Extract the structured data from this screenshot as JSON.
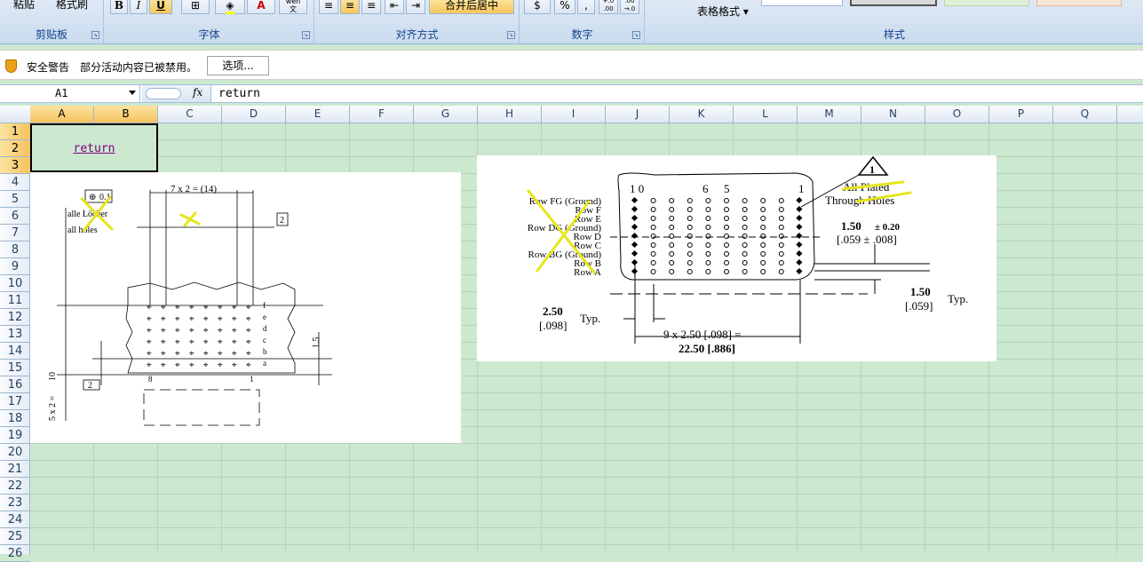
{
  "ribbon": {
    "clipboard": {
      "label": "剪贴板",
      "paste": "粘贴",
      "format_painter": "格式刷"
    },
    "font": {
      "label": "字体",
      "bold": "B",
      "italic": "I",
      "underline": "U",
      "font_color": "A",
      "phonetic": "wén\n文"
    },
    "alignment": {
      "label": "对齐方式",
      "merge_center": "合并后居中"
    },
    "number": {
      "label": "数字",
      "percent": "%",
      "comma": ",",
      "inc_dec": "+.0\n.00",
      "dec_dec": ".00\n→.0"
    },
    "styles": {
      "label": "样式",
      "table_format": "表格格式"
    }
  },
  "security_bar": {
    "title": "安全警告",
    "message": "部分活动内容已被禁用。",
    "options_button": "选项..."
  },
  "formula_bar": {
    "name_box": "A1",
    "fx": "fx",
    "content": "return"
  },
  "columns": [
    "A",
    "B",
    "C",
    "D",
    "E",
    "F",
    "G",
    "H",
    "I",
    "J",
    "K",
    "L",
    "M",
    "N",
    "O",
    "P",
    "Q"
  ],
  "rows": [
    "1",
    "2",
    "3",
    "4",
    "5",
    "6",
    "7",
    "8",
    "9",
    "10",
    "11",
    "12",
    "13",
    "14",
    "15",
    "16",
    "17",
    "18",
    "19",
    "20",
    "21",
    "22",
    "23",
    "24",
    "25",
    "26"
  ],
  "cell_a1": {
    "text": "return"
  },
  "image_left": {
    "dim_top": "7 x  2  =  (14)",
    "tol": "0.1",
    "note1": "alle Löcher",
    "note2": "all holes",
    "box2_a": "2",
    "box2_b": "2",
    "box2_c": "2",
    "rows_labels": [
      "f",
      "e",
      "d",
      "c",
      "b",
      "a"
    ],
    "pin_8": "8",
    "pin_1": "1",
    "dim_right": "1.5",
    "dim_left_a": "10",
    "dim_left_b": "5 x 2 ="
  },
  "image_right": {
    "col_labels": [
      "1 0",
      "6",
      "5",
      "1"
    ],
    "triangle": "1",
    "plated": "All Plated",
    "through": "Through Holes",
    "row_labels": [
      "Row FG (Ground)",
      "Row F",
      "Row E",
      "Row DG (Ground)",
      "Row D",
      "Row C",
      "Row BG (Ground)",
      "Row B",
      "Row A"
    ],
    "dim1_main": "1.50",
    "dim1_tol": "± 0.20",
    "dim1_inch": "[.059 ± .008]",
    "dim2_main": "1.50",
    "dim2_inch": "[.059]",
    "dim2_typ": "Typ.",
    "dim3_main": "2.50",
    "dim3_inch": "[.098]",
    "dim3_typ": "Typ.",
    "dim4_line1": "9 x 2.50 [.098] =",
    "dim4_line2": "22.50 [.886]"
  }
}
